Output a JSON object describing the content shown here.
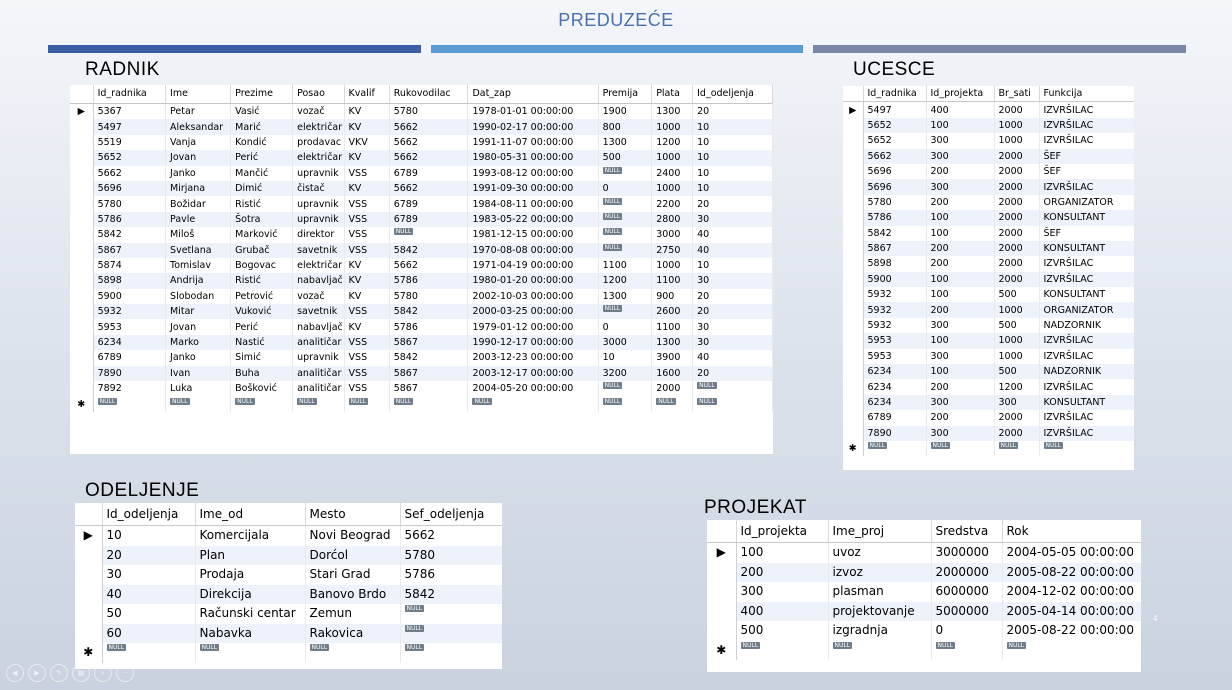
{
  "slide": {
    "title": "PREDUZEĆE",
    "page_number": "4"
  },
  "radnik": {
    "title": "RADNIK",
    "columns": [
      "Id_radnika",
      "Ime",
      "Prezime",
      "Posao",
      "Kvalif",
      "Rukovodilac",
      "Dat_zap",
      "Premija",
      "Plata",
      "Id_odeljenja"
    ],
    "rows": [
      [
        "5367",
        "Petar",
        "Vasić",
        "vozač",
        "KV",
        "5780",
        "1978-01-01 00:00:00",
        "1900",
        "1300",
        "20"
      ],
      [
        "5497",
        "Aleksandar",
        "Marić",
        "električar",
        "KV",
        "5662",
        "1990-02-17 00:00:00",
        "800",
        "1000",
        "10"
      ],
      [
        "5519",
        "Vanja",
        "Kondić",
        "prodavac",
        "VKV",
        "5662",
        "1991-11-07 00:00:00",
        "1300",
        "1200",
        "10"
      ],
      [
        "5652",
        "Jovan",
        "Perić",
        "električar",
        "KV",
        "5662",
        "1980-05-31 00:00:00",
        "500",
        "1000",
        "10"
      ],
      [
        "5662",
        "Janko",
        "Mančić",
        "upravnik",
        "VSS",
        "6789",
        "1993-08-12 00:00:00",
        "NULL",
        "2400",
        "10"
      ],
      [
        "5696",
        "Mirjana",
        "Dimić",
        "čistač",
        "KV",
        "5662",
        "1991-09-30 00:00:00",
        "0",
        "1000",
        "10"
      ],
      [
        "5780",
        "Božidar",
        "Ristić",
        "upravnik",
        "VSS",
        "6789",
        "1984-08-11 00:00:00",
        "NULL",
        "2200",
        "20"
      ],
      [
        "5786",
        "Pavle",
        "Šotra",
        "upravnik",
        "VSS",
        "6789",
        "1983-05-22 00:00:00",
        "NULL",
        "2800",
        "30"
      ],
      [
        "5842",
        "Miloš",
        "Marković",
        "direktor",
        "VSS",
        "NULL",
        "1981-12-15 00:00:00",
        "NULL",
        "3000",
        "40"
      ],
      [
        "5867",
        "Svetlana",
        "Grubač",
        "savetnik",
        "VSS",
        "5842",
        "1970-08-08 00:00:00",
        "NULL",
        "2750",
        "40"
      ],
      [
        "5874",
        "Tomislav",
        "Bogovac",
        "električar",
        "KV",
        "5662",
        "1971-04-19 00:00:00",
        "1100",
        "1000",
        "10"
      ],
      [
        "5898",
        "Andrija",
        "Ristić",
        "nabavljač",
        "KV",
        "5786",
        "1980-01-20 00:00:00",
        "1200",
        "1100",
        "30"
      ],
      [
        "5900",
        "Slobodan",
        "Petrović",
        "vozač",
        "KV",
        "5780",
        "2002-10-03 00:00:00",
        "1300",
        "900",
        "20"
      ],
      [
        "5932",
        "Mitar",
        "Vuković",
        "savetnik",
        "VSS",
        "5842",
        "2000-03-25 00:00:00",
        "NULL",
        "2600",
        "20"
      ],
      [
        "5953",
        "Jovan",
        "Perić",
        "nabavljač",
        "KV",
        "5786",
        "1979-01-12 00:00:00",
        "0",
        "1100",
        "30"
      ],
      [
        "6234",
        "Marko",
        "Nastić",
        "analitičar",
        "VSS",
        "5867",
        "1990-12-17 00:00:00",
        "3000",
        "1300",
        "30"
      ],
      [
        "6789",
        "Janko",
        "Simić",
        "upravnik",
        "VSS",
        "5842",
        "2003-12-23 00:00:00",
        "10",
        "3900",
        "40"
      ],
      [
        "7890",
        "Ivan",
        "Buha",
        "analitičar",
        "VSS",
        "5867",
        "2003-12-17 00:00:00",
        "3200",
        "1600",
        "20"
      ],
      [
        "7892",
        "Luka",
        "Bošković",
        "analitičar",
        "VSS",
        "5867",
        "2004-05-20 00:00:00",
        "NULL",
        "2000",
        "NULL"
      ]
    ]
  },
  "ucesce": {
    "title": "UCESCE",
    "columns": [
      "Id_radnika",
      "Id_projekta",
      "Br_sati",
      "Funkcija"
    ],
    "rows": [
      [
        "5497",
        "400",
        "2000",
        "IZVRŠILAC"
      ],
      [
        "5652",
        "100",
        "1000",
        "IZVRŠILAC"
      ],
      [
        "5652",
        "300",
        "1000",
        "IZVRŠILAC"
      ],
      [
        "5662",
        "300",
        "2000",
        "ŠEF"
      ],
      [
        "5696",
        "200",
        "2000",
        "ŠEF"
      ],
      [
        "5696",
        "300",
        "2000",
        "IZVRŠILAC"
      ],
      [
        "5780",
        "200",
        "2000",
        "ORGANIZATOR"
      ],
      [
        "5786",
        "100",
        "2000",
        "KONSULTANT"
      ],
      [
        "5842",
        "100",
        "2000",
        "ŠEF"
      ],
      [
        "5867",
        "200",
        "2000",
        "KONSULTANT"
      ],
      [
        "5898",
        "200",
        "2000",
        "IZVRŠILAC"
      ],
      [
        "5900",
        "100",
        "2000",
        "IZVRŠILAC"
      ],
      [
        "5932",
        "100",
        "500",
        "KONSULTANT"
      ],
      [
        "5932",
        "200",
        "1000",
        "ORGANIZATOR"
      ],
      [
        "5932",
        "300",
        "500",
        "NADZORNIK"
      ],
      [
        "5953",
        "100",
        "1000",
        "IZVRŠILAC"
      ],
      [
        "5953",
        "300",
        "1000",
        "IZVRŠILAC"
      ],
      [
        "6234",
        "100",
        "500",
        "NADZORNIK"
      ],
      [
        "6234",
        "200",
        "1200",
        "IZVRŠILAC"
      ],
      [
        "6234",
        "300",
        "300",
        "KONSULTANT"
      ],
      [
        "6789",
        "200",
        "2000",
        "IZVRŠILAC"
      ],
      [
        "7890",
        "300",
        "2000",
        "IZVRŠILAC"
      ]
    ]
  },
  "odeljenje": {
    "title": "ODELJENJE",
    "columns": [
      "Id_odeljenja",
      "Ime_od",
      "Mesto",
      "Sef_odeljenja"
    ],
    "rows": [
      [
        "10",
        "Komercijala",
        "Novi Beograd",
        "5662"
      ],
      [
        "20",
        "Plan",
        "Dorćol",
        "5780"
      ],
      [
        "30",
        "Prodaja",
        "Stari Grad",
        "5786"
      ],
      [
        "40",
        "Direkcija",
        "Banovo Brdo",
        "5842"
      ],
      [
        "50",
        "Računski centar",
        "Zemun",
        "NULL"
      ],
      [
        "60",
        "Nabavka",
        "Rakovica",
        "NULL"
      ]
    ]
  },
  "projekat": {
    "title": "PROJEKAT",
    "columns": [
      "Id_projekta",
      "Ime_proj",
      "Sredstva",
      "Rok"
    ],
    "rows": [
      [
        "100",
        "uvoz",
        "3000000",
        "2004-05-05 00:00:00"
      ],
      [
        "200",
        "izvoz",
        "2000000",
        "2005-08-22 00:00:00"
      ],
      [
        "300",
        "plasman",
        "6000000",
        "2004-12-02 00:00:00"
      ],
      [
        "400",
        "projektovanje",
        "5000000",
        "2005-04-14 00:00:00"
      ],
      [
        "500",
        "izgradnja",
        "0",
        "2005-08-22 00:00:00"
      ]
    ]
  },
  "labels": {
    "null": "NULL",
    "current_row_marker": "▶",
    "new_row_marker": "✱"
  },
  "icons": [
    "prev-icon",
    "next-icon",
    "pen-icon",
    "slides-icon",
    "zoom-icon",
    "more-icon"
  ]
}
